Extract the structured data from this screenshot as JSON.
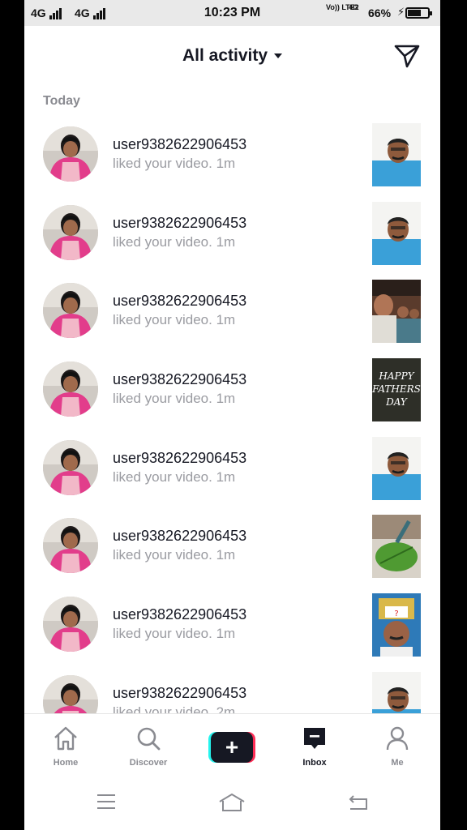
{
  "status_bar": {
    "left_signal_1": "4G",
    "left_signal_2": "4G",
    "time": "10:23 PM",
    "volte_label": "Vo)) LTE2",
    "network_label": "4G",
    "battery_percent": "66%",
    "battery_level": 0.66
  },
  "header": {
    "title": "All activity",
    "dm_icon": "paper-plane-icon"
  },
  "section_label": "Today",
  "notifications": [
    {
      "username": "user9382622906453",
      "action": "liked your video.",
      "time": "1m",
      "thumb_icon": "man-portrait-thumbnail"
    },
    {
      "username": "user9382622906453",
      "action": "liked your video.",
      "time": "1m",
      "thumb_icon": "man-portrait-thumbnail"
    },
    {
      "username": "user9382622906453",
      "action": "liked your video.",
      "time": "1m",
      "thumb_icon": "family-selfie-thumbnail"
    },
    {
      "username": "user9382622906453",
      "action": "liked your video.",
      "time": "1m",
      "thumb_icon": "fathers-day-card-thumbnail",
      "thumb_text": "HAPPY FATHERS DAY"
    },
    {
      "username": "user9382622906453",
      "action": "liked your video.",
      "time": "1m",
      "thumb_icon": "man-portrait-thumbnail"
    },
    {
      "username": "user9382622906453",
      "action": "liked your video.",
      "time": "1m",
      "thumb_icon": "leaf-art-thumbnail"
    },
    {
      "username": "user9382622906453",
      "action": "liked your video.",
      "time": "1m",
      "thumb_icon": "man-with-sticker-thumbnail"
    },
    {
      "username": "user9382622906453",
      "action": "liked your video.",
      "time": "2m",
      "thumb_icon": "man-portrait-thumbnail"
    }
  ],
  "tab_bar": {
    "home": "Home",
    "discover": "Discover",
    "create_symbol": "+",
    "inbox": "Inbox",
    "me": "Me",
    "active_tab": "Inbox"
  },
  "system_nav": {
    "menu_icon": "menu-icon",
    "home_icon": "home-outline-icon",
    "back_icon": "back-icon"
  }
}
